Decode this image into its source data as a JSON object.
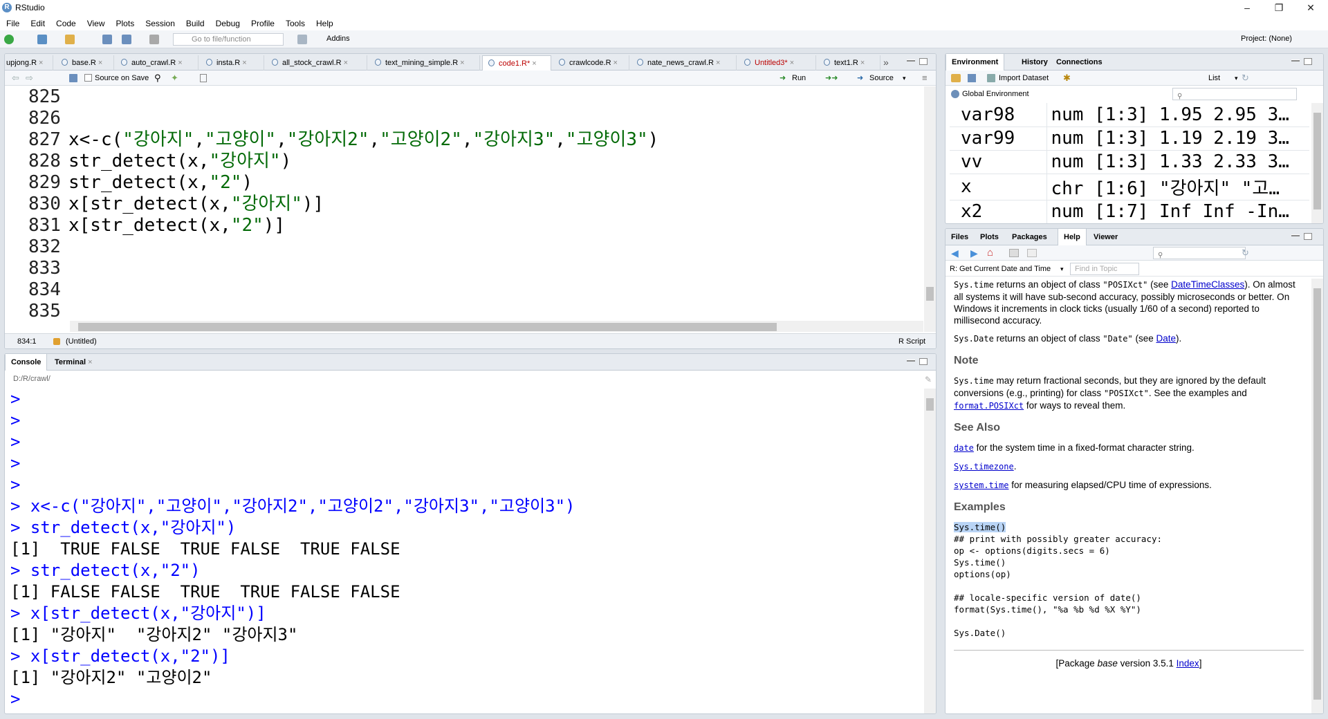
{
  "window": {
    "title": "RStudio"
  },
  "menu": [
    "File",
    "Edit",
    "Code",
    "View",
    "Plots",
    "Session",
    "Build",
    "Debug",
    "Profile",
    "Tools",
    "Help"
  ],
  "toolbar": {
    "goto_placeholder": "Go to file/function",
    "addins": "Addins",
    "project": "Project: (None)"
  },
  "editor": {
    "tabs": [
      {
        "label": "upjong.R"
      },
      {
        "label": "base.R"
      },
      {
        "label": "auto_crawl.R"
      },
      {
        "label": "insta.R"
      },
      {
        "label": "all_stock_crawl.R"
      },
      {
        "label": "text_mining_simple.R"
      },
      {
        "label": "code1.R*"
      },
      {
        "label": "crawlcode.R"
      },
      {
        "label": "nate_news_crawl.R"
      },
      {
        "label": "Untitled3*"
      },
      {
        "label": "text1.R"
      }
    ],
    "source_on_save": "Source on Save",
    "run": "Run",
    "source": "Source",
    "lines": [
      {
        "num": "825",
        "code": ""
      },
      {
        "num": "826",
        "code": ""
      },
      {
        "num": "827",
        "code": "x<-c(\"강아지\",\"고양이\",\"강아지2\",\"고양이2\",\"강아지3\",\"고양이3\")"
      },
      {
        "num": "828",
        "code": "str_detect(x,\"강아지\")"
      },
      {
        "num": "829",
        "code": "str_detect(x,\"2\")"
      },
      {
        "num": "830",
        "code": "x[str_detect(x,\"강아지\")]"
      },
      {
        "num": "831",
        "code": "x[str_detect(x,\"2\")]"
      },
      {
        "num": "832",
        "code": ""
      },
      {
        "num": "833",
        "code": ""
      },
      {
        "num": "834",
        "code": ""
      },
      {
        "num": "835",
        "code": ""
      }
    ],
    "status_pos": "834:1",
    "status_scope": "(Untitled)",
    "status_type": "R Script"
  },
  "console": {
    "tabs": [
      "Console",
      "Terminal"
    ],
    "path": "D:/R/crawl/",
    "lines": [
      {
        "kind": "prompt",
        "text": ">"
      },
      {
        "kind": "prompt",
        "text": ">"
      },
      {
        "kind": "prompt",
        "text": ">"
      },
      {
        "kind": "prompt",
        "text": ">"
      },
      {
        "kind": "prompt",
        "text": ">"
      },
      {
        "kind": "cmd",
        "text": "> x<-c(\"강아지\",\"고양이\",\"강아지2\",\"고양이2\",\"강아지3\",\"고양이3\")"
      },
      {
        "kind": "cmd",
        "text": "> str_detect(x,\"강아지\")"
      },
      {
        "kind": "out",
        "text": "[1]  TRUE FALSE  TRUE FALSE  TRUE FALSE"
      },
      {
        "kind": "cmd",
        "text": "> str_detect(x,\"2\")"
      },
      {
        "kind": "out",
        "text": "[1] FALSE FALSE  TRUE  TRUE FALSE FALSE"
      },
      {
        "kind": "cmd",
        "text": "> x[str_detect(x,\"강아지\")]"
      },
      {
        "kind": "out",
        "text": "[1] \"강아지\"  \"강아지2\" \"강아지3\""
      },
      {
        "kind": "cmd",
        "text": "> x[str_detect(x,\"2\")]"
      },
      {
        "kind": "out",
        "text": "[1] \"강아지2\" \"고양이2\""
      },
      {
        "kind": "prompt",
        "text": ">"
      }
    ]
  },
  "environment": {
    "tabs": [
      "Environment",
      "History",
      "Connections"
    ],
    "import_dataset": "Import Dataset",
    "list_view": "List",
    "scope": "Global Environment",
    "rows": [
      {
        "name": "var98",
        "value": "num [1:3] 1.95 2.95 3…"
      },
      {
        "name": "var99",
        "value": "num [1:3] 1.19 2.19 3…"
      },
      {
        "name": "vv",
        "value": "num [1:3] 1.33 2.33 3…"
      },
      {
        "name": "x",
        "value": "chr [1:6] \"강아지\" \"고…"
      },
      {
        "name": "x2",
        "value": "num [1:7] Inf Inf -In…"
      }
    ]
  },
  "help": {
    "tabs": [
      "Files",
      "Plots",
      "Packages",
      "Help",
      "Viewer"
    ],
    "topic": "R: Get Current Date and Time",
    "find_placeholder": "Find in Topic",
    "p1_code": "Sys.time",
    "p1_text1": " returns an object of class ",
    "p1_code2": "\"POSIXct\"",
    "p1_text2": " (see ",
    "p1_link": "DateTimeClasses",
    "p1_text3": "). On almost all systems it will have sub-second accuracy, possibly microseconds or better. On Windows it increments in clock ticks (usually 1/60 of a second) reported to millisecond accuracy.",
    "p2_code": "Sys.Date",
    "p2_text1": " returns an object of class ",
    "p2_code2": "\"Date\"",
    "p2_text2": " (see ",
    "p2_link": "Date",
    "p2_text3": ").",
    "note_heading": "Note",
    "note_code": "Sys.time",
    "note_text1": " may return fractional seconds, but they are ignored by the default conversions (e.g., printing) for class ",
    "note_code2": "\"POSIXct\"",
    "note_text2": ". See the examples and ",
    "note_link": "format.POSIXct",
    "note_text3": " for ways to reveal them.",
    "seealso_heading": "See Also",
    "sa1_link": "date",
    "sa1_text": " for the system time in a fixed-format character string.",
    "sa2_link": "Sys.timezone",
    "sa2_text": ".",
    "sa3_link": "system.time",
    "sa3_text": " for measuring elapsed/CPU time of expressions.",
    "examples_heading": "Examples",
    "ex_sel": "Sys.time()",
    "ex_rest": "## print with possibly greater accuracy:\nop <- options(digits.secs = 6)\nSys.time()\noptions(op)\n\n## locale-specific version of date()\nformat(Sys.time(), \"%a %b %d %X %Y\")\n\nSys.Date()",
    "footer_pre": "[Package ",
    "footer_pkg": "base",
    "footer_mid": " version 3.5.1 ",
    "footer_link": "Index",
    "footer_post": "]"
  }
}
